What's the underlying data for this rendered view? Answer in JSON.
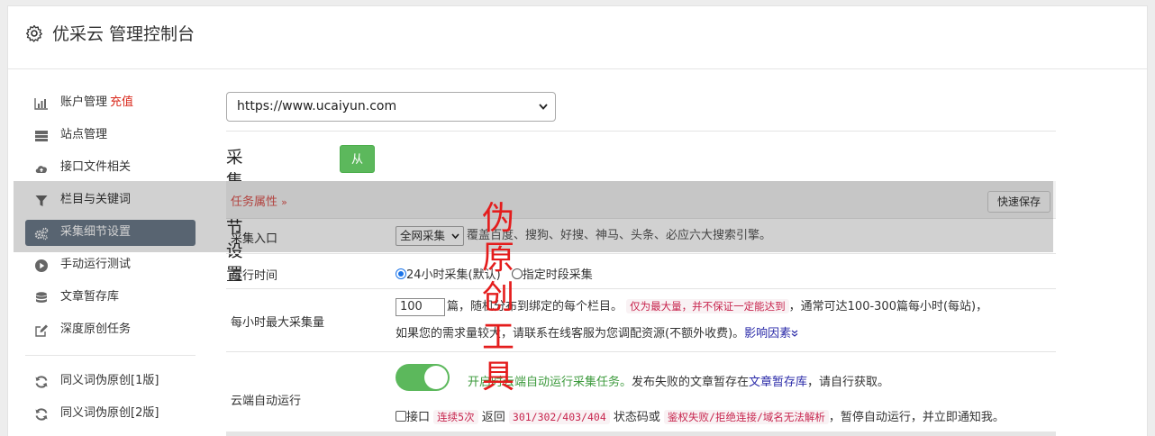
{
  "header": {
    "title": "优采云 管理控制台"
  },
  "sidebar": {
    "items": [
      {
        "label": "账户管理",
        "tag": "充值",
        "icon": "bar-chart-icon"
      },
      {
        "label": "站点管理",
        "icon": "server-icon"
      },
      {
        "label": "接口文件相关",
        "icon": "cloud-upload-icon"
      },
      {
        "label": "栏目与关键词",
        "icon": "filter-icon"
      },
      {
        "label": "采集细节设置",
        "icon": "gears-icon",
        "active": true
      },
      {
        "label": "手动运行测试",
        "icon": "play-circle-icon"
      },
      {
        "label": "文章暂存库",
        "icon": "database-icon"
      },
      {
        "label": "深度原创任务",
        "icon": "edit-icon"
      },
      {
        "label": "同义词伪原创[1版]",
        "icon": "refresh-icon"
      },
      {
        "label": "同义词伪原创[2版]",
        "icon": "refresh-icon"
      }
    ]
  },
  "site_select": {
    "value": "https://www.ucaiyun.com"
  },
  "section": {
    "title": "采集细节设置",
    "import_button": "从模板导入"
  },
  "task_header": {
    "label": "任务属性",
    "chevron": "»",
    "save_button": "快速保存"
  },
  "rows": {
    "entry": {
      "label": "采集入口",
      "select_value": "全网采集",
      "desc": "覆盖百度、搜狗、好搜、神马、头条、必应六大搜索引擎。"
    },
    "runtime": {
      "label": "运行时间",
      "option1": "24小时采集(默认)",
      "option2": "指定时段采集"
    },
    "max": {
      "label": "每小时最大采集量",
      "value": "100",
      "text1": "篇，随机分布到绑定的每个栏目。",
      "code1": "仅为最大量，并不保证一定能达到",
      "text2": "，通常可达100-300篇每小时(每站)，",
      "text3": "如果您的需求量较大，请联系在线客服为您调配资源(不额外收费)。",
      "link": "影响因素"
    },
    "cloud": {
      "label": "云端自动运行",
      "toggle_on": true,
      "green_text": "开启时云端自动运行采集任务。",
      "text1": "发布失败的文章暂存在",
      "link": "文章暂存库",
      "text2": "，请自行获取。",
      "check_label": "接口",
      "code1": "连续5次",
      "text3": "返回",
      "code2": "301/302/403/404",
      "text4": "状态码或",
      "code3": "鉴权失败/拒绝连接/域名无法解析",
      "text5": "，暂停自动运行，并立即通知我。"
    }
  },
  "watermark": "伪原创工具",
  "colors": {
    "accent_green": "#5cb85c",
    "active_sidebar": "#6c7a8a",
    "danger": "#d9534f",
    "code": "#c7254e",
    "watermark": "#e41d1d"
  }
}
